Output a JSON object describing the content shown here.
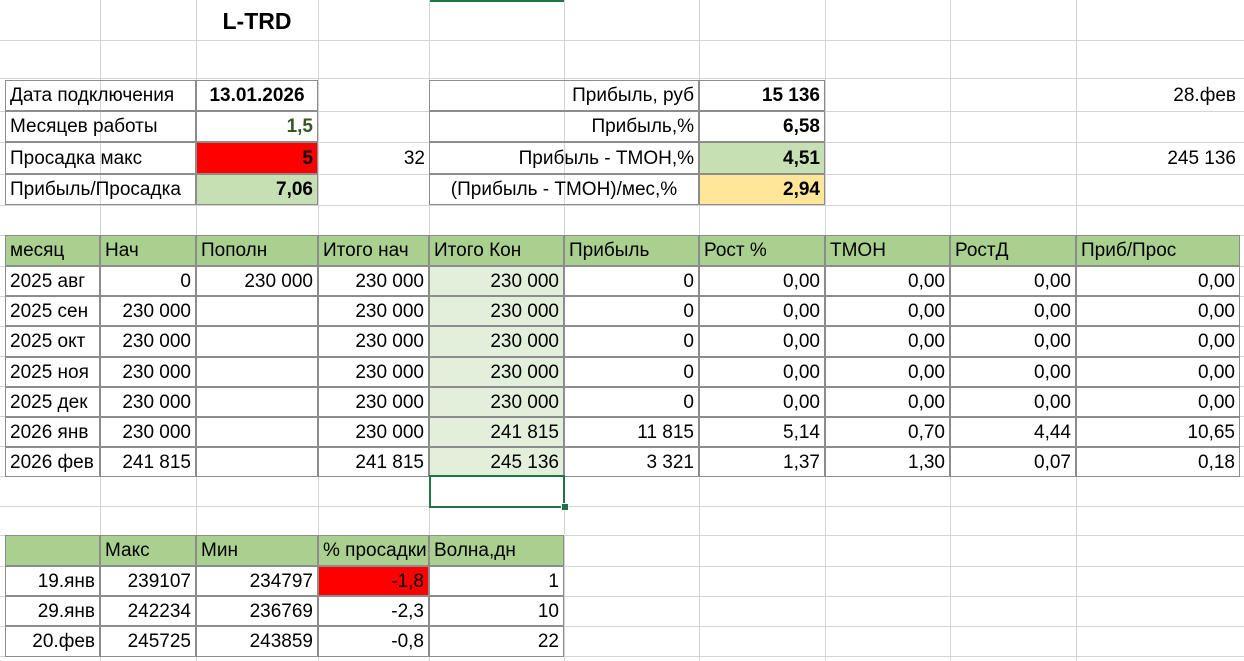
{
  "title": "L-TRD",
  "summary_left": [
    {
      "label": "Дата подключения",
      "value": "13.01.2026"
    },
    {
      "label": "Месяцев работы",
      "value": "1,5"
    },
    {
      "label": "Просадка макс",
      "value": "5",
      "extra": "32"
    },
    {
      "label": "Прибыль/Просадка",
      "value": "7,06"
    }
  ],
  "summary_right": [
    {
      "label": "Прибыль, руб",
      "value": "15 136",
      "extra": "28.фев"
    },
    {
      "label": "Прибыль,%",
      "value": "6,58"
    },
    {
      "label": "Прибыль - ТМОН,%",
      "value": "4,51",
      "extra": "245 136"
    },
    {
      "label": "(Прибыль - ТМОН)/мес,%",
      "value": "2,94"
    }
  ],
  "monthly": {
    "headers": [
      "месяц",
      "Нач",
      "Пополн",
      "Итого нач",
      "Итого Кон",
      "Прибыль",
      "Рост %",
      "ТМОН",
      "РостД",
      "Приб/Прос"
    ],
    "rows": [
      [
        "2025 авг",
        "0",
        "230 000",
        "230 000",
        "230 000",
        "0",
        "0,00",
        "0,00",
        "0,00",
        "0,00"
      ],
      [
        "2025 сен",
        "230 000",
        "",
        "230 000",
        "230 000",
        "0",
        "0,00",
        "0,00",
        "0,00",
        "0,00"
      ],
      [
        "2025 окт",
        "230 000",
        "",
        "230 000",
        "230 000",
        "0",
        "0,00",
        "0,00",
        "0,00",
        "0,00"
      ],
      [
        "2025 ноя",
        "230 000",
        "",
        "230 000",
        "230 000",
        "0",
        "0,00",
        "0,00",
        "0,00",
        "0,00"
      ],
      [
        "2025 дек",
        "230 000",
        "",
        "230 000",
        "230 000",
        "0",
        "0,00",
        "0,00",
        "0,00",
        "0,00"
      ],
      [
        "2026 янв",
        "230 000",
        "",
        "230 000",
        "241 815",
        "11 815",
        "5,14",
        "0,70",
        "4,44",
        "10,65"
      ],
      [
        "2026 фев",
        "241 815",
        "",
        "241 815",
        "245 136",
        "3 321",
        "1,37",
        "1,30",
        "0,07",
        "0,18"
      ]
    ]
  },
  "drawdown": {
    "headers": [
      "",
      "Макс",
      "Мин",
      "% просадки",
      "Волна,дн"
    ],
    "rows": [
      [
        "19.янв",
        "239107",
        "234797",
        "-1,8",
        "1"
      ],
      [
        "29.янв",
        "242234",
        "236769",
        "-2,3",
        "10"
      ],
      [
        "20.фев",
        "245725",
        "243859",
        "-0,8",
        "22"
      ]
    ]
  },
  "colors": {
    "header_green": "#a9d08e",
    "light_green": "#c6e0b4",
    "pale_green": "#e2efda",
    "red": "#ff0000",
    "yellow": "#ffe699",
    "dark_green_text": "#375623",
    "selection": "#217346"
  }
}
